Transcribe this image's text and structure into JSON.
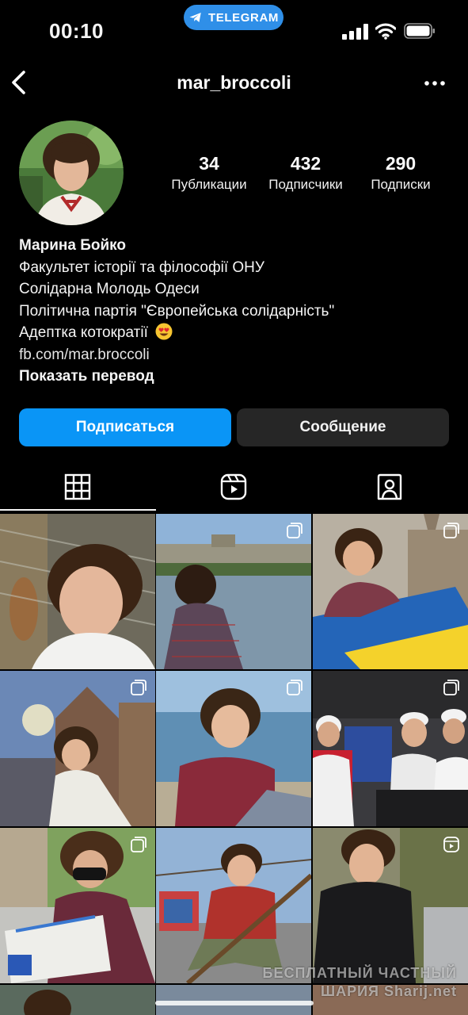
{
  "status_bar": {
    "time": "00:10",
    "pill_label": "TELEGRAM"
  },
  "header": {
    "username": "mar_broccoli"
  },
  "profile": {
    "stats": [
      {
        "value": "34",
        "label": "Публикации"
      },
      {
        "value": "432",
        "label": "Подписчики"
      },
      {
        "value": "290",
        "label": "Подписки"
      }
    ],
    "name": "Марина Бойко",
    "bio_lines": [
      "Факультет історії та філософії ОНУ",
      "Солідарна Молодь Одеси",
      "Політична партія \"Європейська солідарність\"",
      "Адептка котократії"
    ],
    "link": "fb.com/mar.broccoli",
    "show_translation": "Показать перевод"
  },
  "actions": {
    "follow_label": "Подписаться",
    "message_label": "Сообщение"
  },
  "tabs": [
    {
      "name": "posts",
      "icon": "grid-icon",
      "active": true
    },
    {
      "name": "reels",
      "icon": "reels-icon",
      "active": false
    },
    {
      "name": "tagged",
      "icon": "tagged-icon",
      "active": false
    }
  ],
  "posts": [
    {
      "badge": "none"
    },
    {
      "badge": "multiple-icon"
    },
    {
      "badge": "multiple-icon"
    },
    {
      "badge": "multiple-icon"
    },
    {
      "badge": "multiple-icon"
    },
    {
      "badge": "multiple-icon"
    },
    {
      "badge": "multiple-icon"
    },
    {
      "badge": "none"
    },
    {
      "badge": "reels-icon"
    }
  ],
  "watermark": {
    "line1": "БЕСПЛАТНЫЙ ЧАСТНЫЙ",
    "line2": "ШАРИЯ  Sharij.net"
  },
  "colors": {
    "background": "#000000",
    "accent": "#0a95f6",
    "telegram_pill": "#2f8fe8",
    "secondary_button": "#262626"
  }
}
